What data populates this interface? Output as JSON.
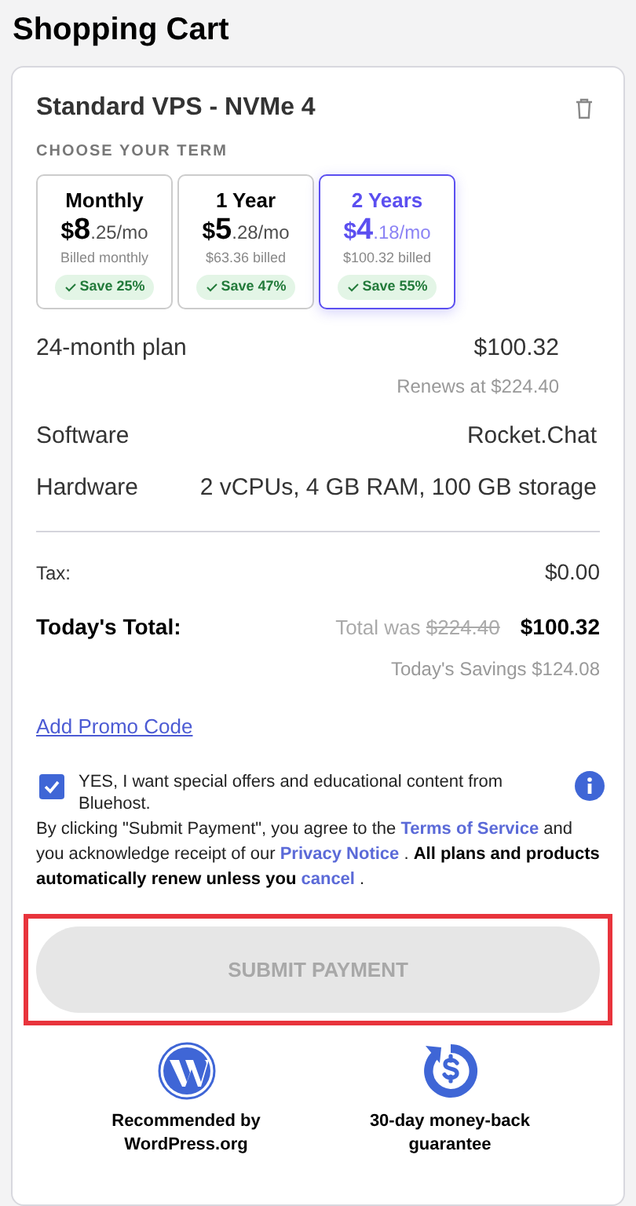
{
  "page_title": "Shopping Cart",
  "product": {
    "name": "Standard VPS - NVMe 4",
    "term_heading": "CHOOSE YOUR TERM"
  },
  "terms": [
    {
      "label": "Monthly",
      "currency": "$",
      "whole": "8",
      "fraction": ".25/mo",
      "billed": "Billed monthly",
      "save": "Save 25%",
      "selected": false
    },
    {
      "label": "1 Year",
      "currency": "$",
      "whole": "5",
      "fraction": ".28/mo",
      "billed": "$63.36 billed",
      "save": "Save 47%",
      "selected": false
    },
    {
      "label": "2 Years",
      "currency": "$",
      "whole": "4",
      "fraction": ".18/mo",
      "billed": "$100.32 billed",
      "save": "Save 55%",
      "selected": true
    }
  ],
  "plan": {
    "label": "24-month plan",
    "price": "$100.32",
    "renews": "Renews at $224.40"
  },
  "details": [
    {
      "label": "Software",
      "value": "Rocket.Chat"
    },
    {
      "label": "Hardware",
      "value": "2 vCPUs, 4 GB RAM, 100 GB storage"
    }
  ],
  "tax": {
    "label": "Tax:",
    "value": "$0.00"
  },
  "total": {
    "label": "Today's Total:",
    "was_label": "Total was",
    "was_price": "$224.40",
    "price": "$100.32",
    "savings": "Today's Savings $124.08"
  },
  "promo_link": "Add Promo Code",
  "offers": {
    "checked": true,
    "label": "YES, I want special offers and educational content from Bluehost."
  },
  "legal": [
    {
      "kind": "text",
      "text": "By clicking \"Submit Payment\", you agree to the"
    },
    {
      "kind": "link",
      "text": "Terms of Service"
    },
    {
      "kind": "text",
      "text": "and you acknowledge receipt of our"
    },
    {
      "kind": "link",
      "text": "Privacy Notice"
    },
    {
      "kind": "text",
      "text": "."
    },
    {
      "kind": "bold",
      "text": "All plans and products automatically renew unless you"
    },
    {
      "kind": "link",
      "text": "cancel"
    },
    {
      "kind": "text",
      "text": "."
    }
  ],
  "submit": {
    "label": "SUBMIT PAYMENT",
    "disabled": true,
    "highlighted": true
  },
  "badges": [
    {
      "kind": "wordpress",
      "text": "Recommended by WordPress.org"
    },
    {
      "kind": "money-back",
      "text": "30-day money-back guarantee"
    }
  ]
}
